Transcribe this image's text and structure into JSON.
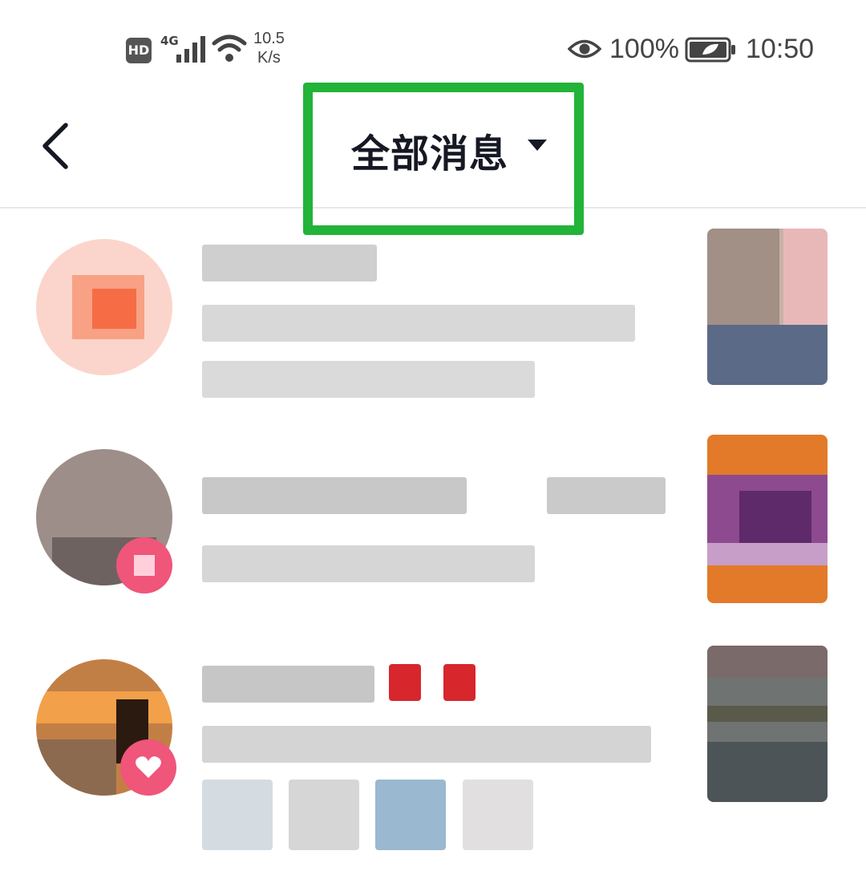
{
  "status_bar": {
    "hd": "HD",
    "network": "4G",
    "speed_value": "10.5",
    "speed_unit": "K/s",
    "battery_percent": "100%",
    "time": "10:50"
  },
  "header": {
    "title": "全部消息",
    "dropdown_icon": "caret-down-icon",
    "back_icon": "chevron-left-icon"
  },
  "messages": [
    {
      "avatar_color": "#f78a6d",
      "thumb_color": "#b8a6a0"
    },
    {
      "avatar_color": "#8a7a76",
      "badge_color": "#f0557a",
      "thumb_color": "#7a3f86"
    },
    {
      "avatar_color": "#c9874a",
      "badge_color": "#f0557a",
      "badge_icon": "heart-icon",
      "thumb_color": "#5c6664"
    }
  ]
}
